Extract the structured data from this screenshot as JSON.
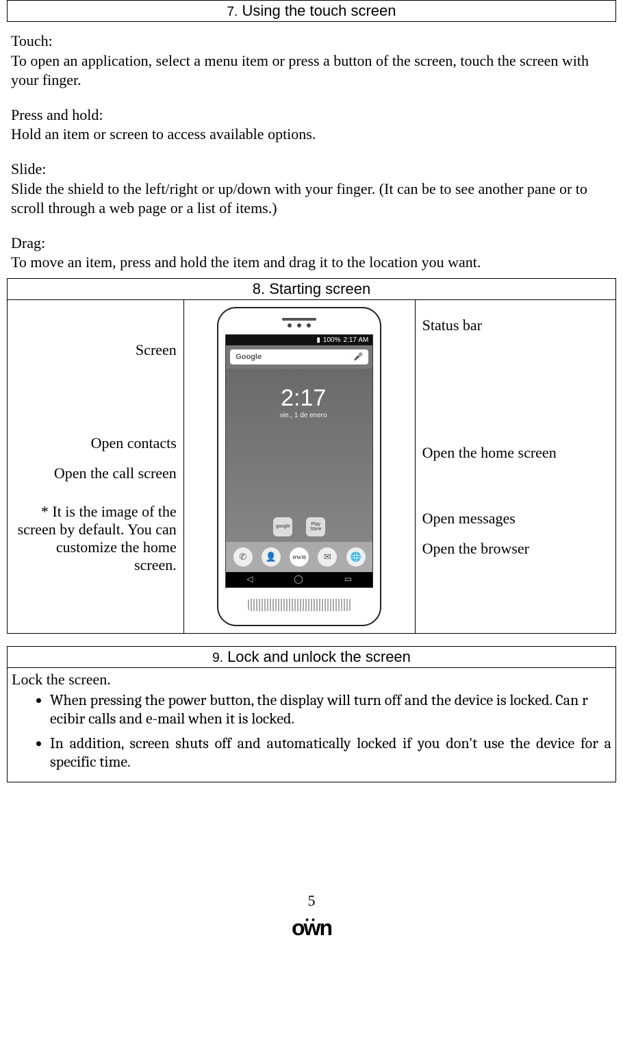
{
  "section7": {
    "num": "7.",
    "title": "Using the touch screen",
    "touch": {
      "label": "Touch:",
      "text": "To open an application, select a menu item or press a button of the screen, touch the screen with your finger."
    },
    "press": {
      "label": "Press and hold:",
      "text": "Hold an item or screen to access available options."
    },
    "slide": {
      "label": "Slide:",
      "text": "Slide the shield to the left/right or up/down with your finger. (It can be to see another pane or to scroll through a web page or a list of items.)"
    },
    "drag": {
      "label": "Drag:",
      "text": "To move an item, press and hold the item and drag it to the location you want."
    }
  },
  "section8": {
    "num": "8.",
    "title": "Starting screen",
    "left": {
      "screen": "Screen",
      "contacts": "Open contacts",
      "call": "Open the call screen",
      "note": "* It is the image of the screen by default. You can customize the home screen."
    },
    "right": {
      "status": "Status bar",
      "home": "Open the home screen",
      "messages": "Open messages",
      "browser": "Open the browser"
    },
    "phone": {
      "battery": "100%",
      "time_status": "2:17 AM",
      "search": "Google",
      "clock_time": "2:17",
      "clock_date": "vie., 1 de enero",
      "app1": "google",
      "app2": "Play Store"
    }
  },
  "section9": {
    "num": "9.",
    "title": "Lock and unlock the screen",
    "intro": "Lock the screen.",
    "bullets": [
      "When pressing the power button, the display will turn off and the device is locked. Can r ecibir calls and e-mail when it is locked.",
      "In addition, screen shuts off and automatically locked if you don't use the device for a specific time."
    ]
  },
  "footer": {
    "page": "5",
    "logo": "öwn"
  }
}
